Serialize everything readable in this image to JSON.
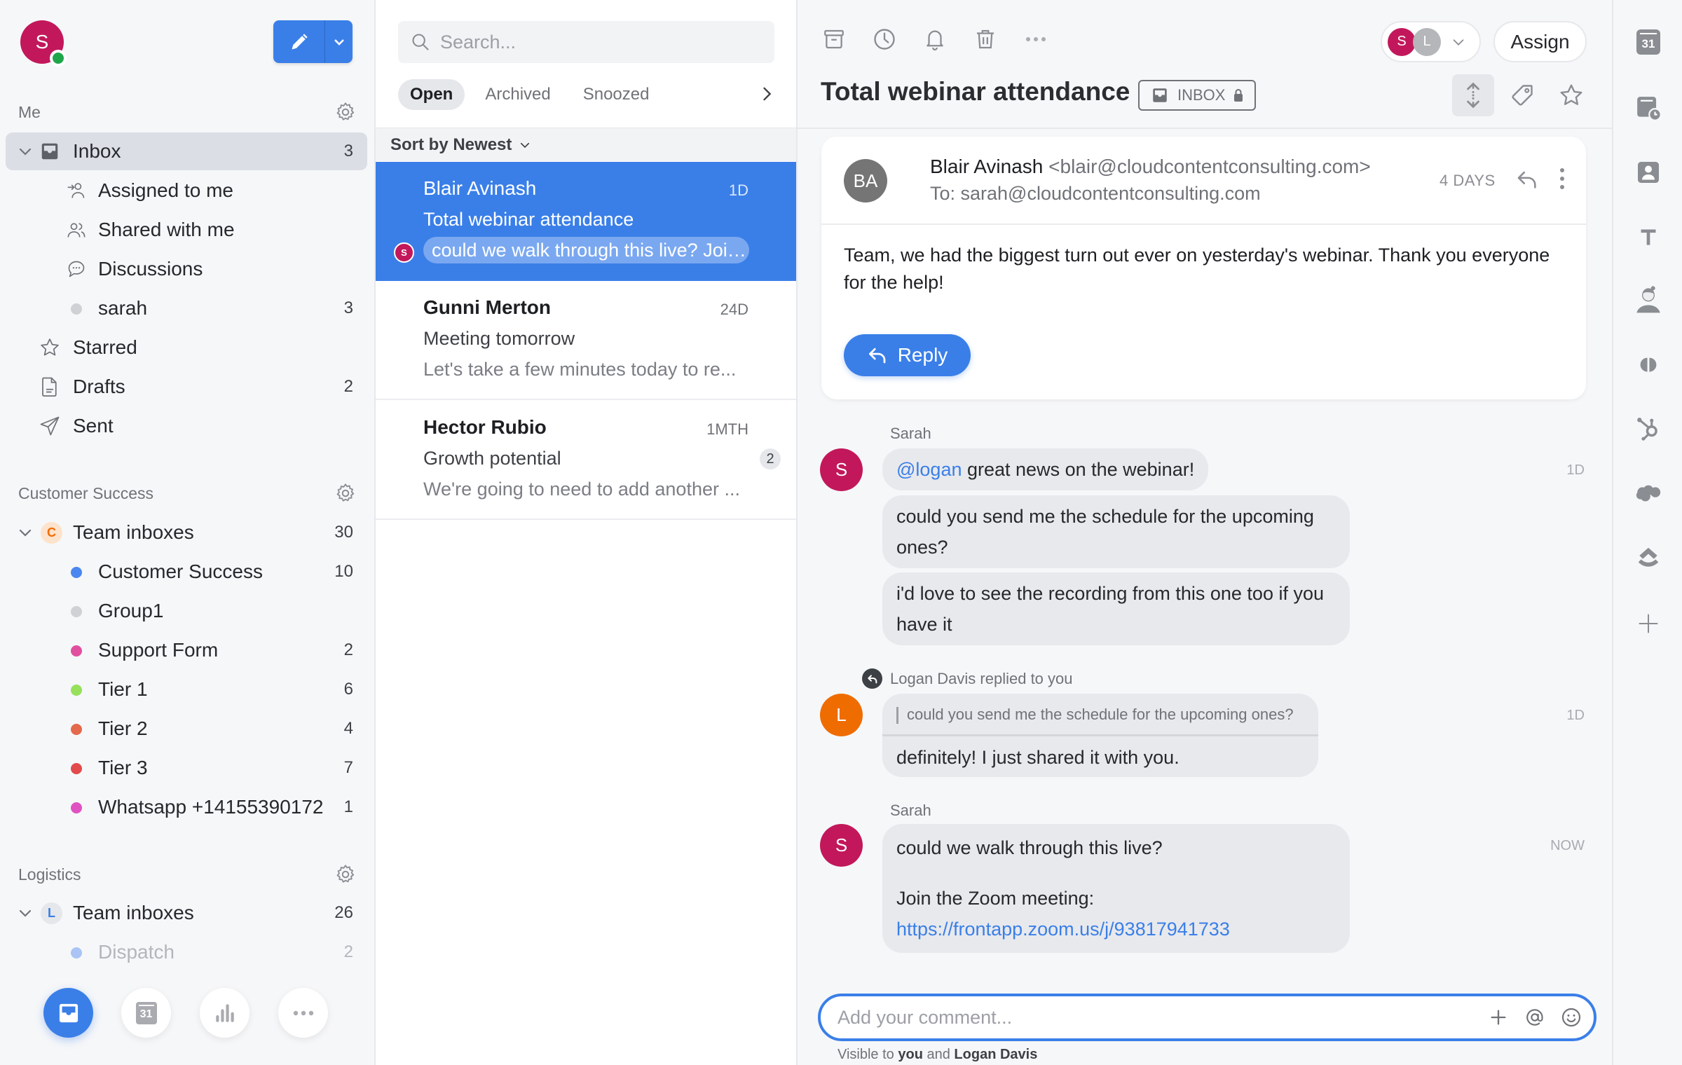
{
  "user": {
    "initial": "S",
    "avatar_color": "#c2185b",
    "presence": "online"
  },
  "compose": {
    "label": "Compose",
    "icon": "pencil-icon"
  },
  "sidebar": {
    "me": {
      "title": "Me",
      "inbox": {
        "label": "Inbox",
        "count": "3"
      },
      "items": [
        {
          "label": "Assigned to me",
          "icon": "assigned-icon",
          "count": ""
        },
        {
          "label": "Shared with me",
          "icon": "shared-icon",
          "count": ""
        },
        {
          "label": "Discussions",
          "icon": "discussion-icon",
          "count": ""
        },
        {
          "label": "sarah",
          "icon": "dot",
          "count": "3",
          "color": "#d0d1d5"
        }
      ],
      "folders": [
        {
          "label": "Starred",
          "icon": "star-icon",
          "count": ""
        },
        {
          "label": "Drafts",
          "icon": "draft-icon",
          "count": "2"
        },
        {
          "label": "Sent",
          "icon": "sent-icon",
          "count": ""
        }
      ]
    },
    "customer_success": {
      "title": "Customer Success",
      "team": {
        "label": "Team inboxes",
        "badge": "C",
        "count": "30"
      },
      "inboxes": [
        {
          "label": "Customer Success",
          "count": "10",
          "color": "#4a87ef"
        },
        {
          "label": "Group1",
          "count": "",
          "color": "#d0d1d5"
        },
        {
          "label": "Support Form",
          "count": "2",
          "color": "#e0509f"
        },
        {
          "label": "Tier 1",
          "count": "6",
          "color": "#96e05b"
        },
        {
          "label": "Tier 2",
          "count": "4",
          "color": "#e46a4c"
        },
        {
          "label": "Tier 3",
          "count": "7",
          "color": "#e24b4b"
        },
        {
          "label": "Whatsapp +14155390172",
          "count": "1",
          "color": "#e052c1"
        }
      ]
    },
    "logistics": {
      "title": "Logistics",
      "team": {
        "label": "Team inboxes",
        "badge": "L",
        "count": "26"
      },
      "inboxes": [
        {
          "label": "Dispatch",
          "count": "2",
          "color": "#a9c4f5"
        }
      ]
    },
    "dock": [
      "inbox-icon",
      "calendar-icon",
      "analytics-icon",
      "more-icon"
    ],
    "dock_calendar_day": "31"
  },
  "list": {
    "search_placeholder": "Search...",
    "tabs": [
      {
        "label": "Open",
        "active": true
      },
      {
        "label": "Archived"
      },
      {
        "label": "Snoozed"
      }
    ],
    "sort_label": "Sort by Newest",
    "conversations": [
      {
        "from": "Blair Avinash",
        "time": "1D",
        "subject": "Total webinar attendance",
        "preview": "could we walk through this live? Join...",
        "selected": true,
        "commenter_initial": "S"
      },
      {
        "from": "Gunni Merton",
        "time": "24D",
        "subject": "Meeting tomorrow",
        "preview": "Let's take a few minutes today to re..."
      },
      {
        "from": "Hector Rubio",
        "time": "1MTH",
        "subject": "Growth potential",
        "preview": "We're going to need to add another ...",
        "badge": "2"
      }
    ]
  },
  "main": {
    "toolbar": [
      "archive-icon",
      "snooze-icon",
      "reminder-icon",
      "trash-icon",
      "more-icon"
    ],
    "assignees": [
      {
        "initial": "S",
        "color": "#c2185b"
      },
      {
        "initial": "L",
        "color": "#b5b6b9"
      }
    ],
    "assign_label": "Assign",
    "subject": "Total webinar attendance",
    "inbox_tag": "INBOX",
    "email": {
      "avatar": "BA",
      "from_name": "Blair Avinash",
      "from_addr": "<blair@cloudcontentconsulting.com>",
      "to": "To: sarah@cloudcontentconsulting.com",
      "age": "4 DAYS",
      "body": "Team, we had the biggest turn out ever on yesterday's webinar. Thank you everyone for the help!",
      "reply_label": "Reply"
    },
    "comments": [
      {
        "author": "Sarah",
        "initial": "S",
        "color": "#c2185b",
        "time": "1D",
        "mention": "@logan",
        "messages": [
          "great news on the webinar!",
          "could you send me the schedule for the upcoming ones?",
          "i'd love to see the recording from this one too if you have it"
        ]
      },
      {
        "author": "Logan Davis replied to you",
        "initial": "L",
        "color": "#ef6c00",
        "time": "1D",
        "quote": "could you send me the schedule for the upcoming ones?",
        "message": "definitely! I just shared it with you."
      },
      {
        "author": "Sarah",
        "initial": "S",
        "color": "#c2185b",
        "time": "NOW",
        "line1": "could we walk through this live?",
        "line2": "Join the Zoom meeting:",
        "link": "https://frontapp.zoom.us/j/93817941733"
      }
    ],
    "comment_placeholder": "Add your comment...",
    "visibility": {
      "prefix": "Visible to",
      "you": "you",
      "and": "and",
      "other": "Logan Davis"
    }
  },
  "rail": {
    "calendar_day": "31",
    "items": [
      "calendar-icon",
      "scheduled-icon",
      "contact-icon",
      "text-snippet-icon",
      "avatar-integration-icon",
      "dialpad-icon",
      "hubspot-icon",
      "salesforce-icon",
      "integration-icon",
      "add-icon"
    ]
  }
}
